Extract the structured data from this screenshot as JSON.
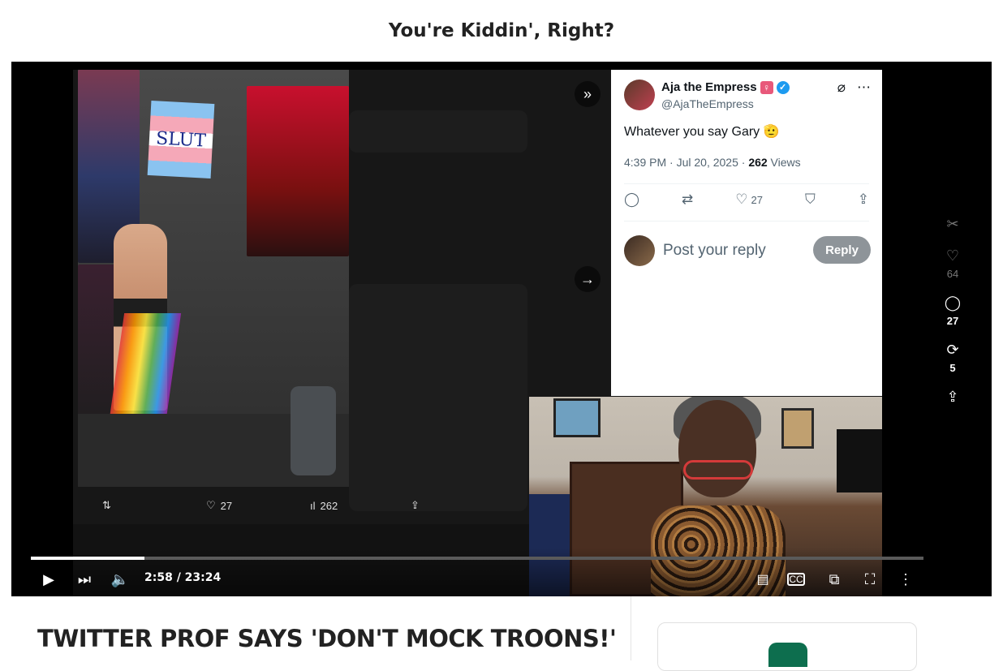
{
  "page": {
    "title": "You're Kiddin', Right?"
  },
  "video": {
    "current_time": "2:58",
    "duration": "23:24",
    "time_label": "2:58 / 23:24",
    "progress_fraction": 0.127,
    "embedded_post": {
      "sign_text": "SLUT",
      "retweet_count": "",
      "like_count": "27",
      "view_count": "262"
    },
    "tweet": {
      "author_name": "Aja the Empress",
      "handle": "@AjaTheEmpress",
      "text": "Whatever you say Gary 🫡",
      "timestamp": "4:39 PM · Jul 20, 2025 · ",
      "views_number": "262",
      "views_label": " Views",
      "like_count": "27",
      "reply_placeholder": "Post your reply",
      "reply_button": "Reply"
    }
  },
  "rail": {
    "likes": "64",
    "comments": "27",
    "restacks": "5"
  },
  "article": {
    "title": "TWITTER PROF SAYS 'DON'T MOCK TROONS!'"
  },
  "colors": {
    "accent": "#1d9bf0",
    "reply_button": "#8e9499",
    "player_bg": "#000000"
  }
}
